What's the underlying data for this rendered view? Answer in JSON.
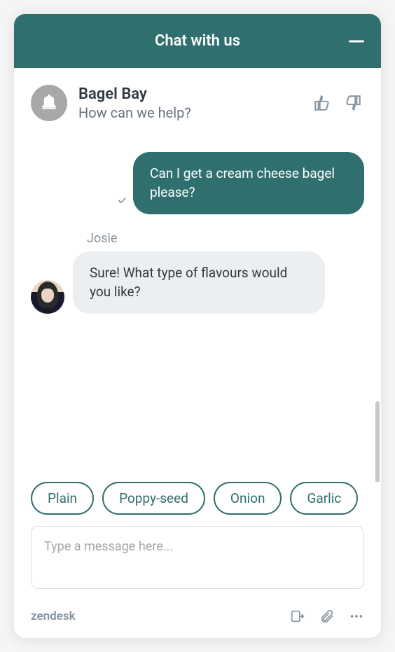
{
  "header": {
    "title": "Chat with us"
  },
  "company": {
    "name": "Bagel Bay",
    "subtitle": "How can we help?"
  },
  "messages": {
    "user_text": "Can I get a cream cheese bagel please?",
    "agent_name": "Josie",
    "agent_text": "Sure! What type of flavours would you like?"
  },
  "quick_replies": [
    "Plain",
    "Poppy-seed",
    "Onion",
    "Garlic"
  ],
  "input": {
    "placeholder": "Type a message here..."
  },
  "footer": {
    "brand": "zendesk"
  }
}
